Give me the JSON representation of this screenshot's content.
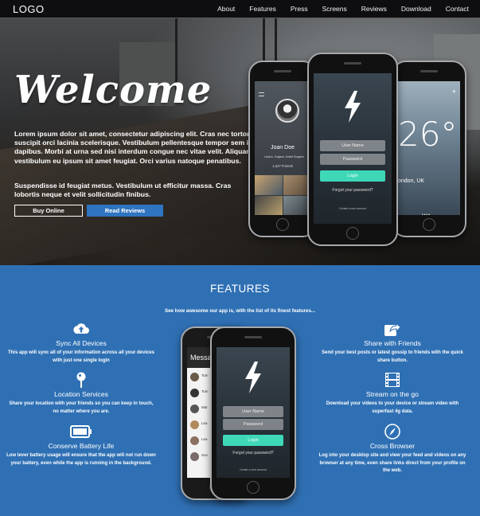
{
  "nav": {
    "logo": "LOGO",
    "links": [
      "About",
      "Features",
      "Press",
      "Screens",
      "Reviews",
      "Download",
      "Contact"
    ]
  },
  "hero": {
    "title": "Welcome",
    "paragraph1": "Lorem ipsum dolor sit amet, consectetur adipiscing elit. Cras nec tortor suscipit orci lacinia scelerisque. Vestibulum pellentesque tempor sem id dapibus. Morbi at urna sed nisi interdum congue nec vitae velit. Aliquam vestibulum eu ipsum sit amet feugiat. Orci varius natoque penatibus.",
    "paragraph2": "Suspendisse id feugiat metus. Vestibulum ut efficitur massa. Cras lobortis neque et velit sollicitudin finibus.",
    "buy_button": "Buy Online",
    "reviews_button": "Read Reviews",
    "phone_profile": {
      "name": "Joan Doe",
      "location": "London, England, United Kingdom",
      "friends": "1,547 Friends"
    },
    "phone_login": {
      "user_placeholder": "User Name",
      "password_placeholder": "Password",
      "login_button": "Login",
      "forgot": "Forgot your password?",
      "create": "Create a new account"
    },
    "phone_weather": {
      "temperature": "26°",
      "location": "ondon, UK"
    }
  },
  "features": {
    "title": "FEATURES",
    "subtitle": "See how awesome our app is, with the list of its finest features...",
    "left": [
      {
        "icon": "cloud-upload-icon",
        "name": "Sync All Devices",
        "desc": "This app will sync all of your information across all your devices with just one single login"
      },
      {
        "icon": "location-pin-icon",
        "name": "Location Services",
        "desc": "Share your location with your friends so you can keep in touch, no matter where you are."
      },
      {
        "icon": "battery-icon",
        "name": "Conserve Battery Life",
        "desc": "Low lever battery usage will ensure that the app will not run down your battery, even while the app is running in the background."
      }
    ],
    "right": [
      {
        "icon": "share-icon",
        "name": "Share with Friends",
        "desc": "Send your best posts or latest gossip to friends with the quick share button."
      },
      {
        "icon": "film-icon",
        "name": "Stream on the go",
        "desc": "Download your videos to your device or stream video with superfast 4g data."
      },
      {
        "icon": "compass-icon",
        "name": "Cross Browser",
        "desc": "Log into your desktop site and view your feed and videos on any browser at any time, even share links direct from your profile on the web."
      }
    ],
    "phone_messages": {
      "title": "Messa",
      "rows": [
        "Tom",
        "Tom",
        "Mar",
        "Lea",
        "Lea",
        "Sus"
      ]
    },
    "phone_login": {
      "user_placeholder": "User Name",
      "password_placeholder": "Password",
      "login_button": "Login",
      "forgot": "Forgot your password?",
      "create": "Create a new account"
    }
  },
  "colors": {
    "accent_blue": "#2f70b4",
    "button_blue": "#2e74c0",
    "login_teal": "#3ed8b8",
    "nav_bg": "#0e0e10"
  }
}
